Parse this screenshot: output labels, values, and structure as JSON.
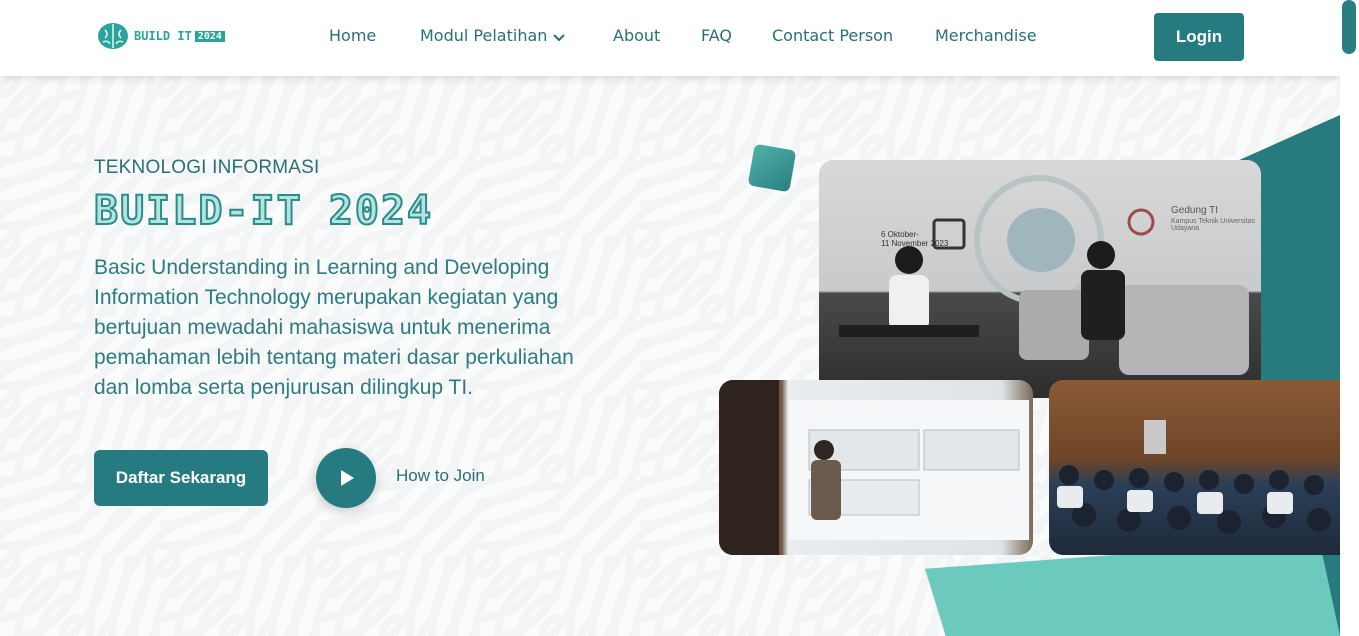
{
  "header": {
    "logo_text": "BUILD IT",
    "logo_year": "2024",
    "nav": [
      "Home",
      "Modul Pelatihan",
      "About",
      "FAQ",
      "Contact Person",
      "Merchandise"
    ],
    "login_label": "Login"
  },
  "hero": {
    "eyebrow": "TEKNOLOGI INFORMASI",
    "title": "BUILD-IT 2024",
    "description": "Basic Understanding in Learning and Developing Information Technology merupakan kegiatan yang bertujuan mewadahi mahasiswa untuk menerima pemahaman lebih tentang materi dasar perkuliahan dan lomba serta penjurusan dilingkup TI.",
    "cta_label": "Daftar Sekarang",
    "howto_label": "How to Join"
  },
  "photos": {
    "a_date": "6 Oktober-\n11 November 2023",
    "a_place": "Gedung TI",
    "a_place_sub": "Kampus Teknik Universitas Udayana"
  },
  "colors": {
    "primary": "#257b7f",
    "accent": "#6cc9bd"
  },
  "icons": [
    "brain-logo-icon",
    "chevron-down-icon",
    "play-icon"
  ]
}
